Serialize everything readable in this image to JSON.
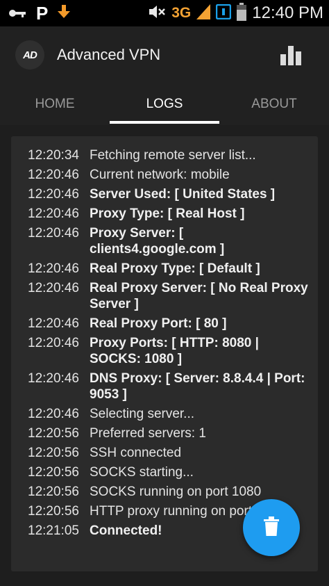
{
  "status_bar": {
    "icons": [
      "key-icon",
      "parking-p-icon",
      "download-arrow-icon",
      "mute-icon",
      "signal-icon",
      "sim-icon",
      "battery-icon"
    ],
    "p_label": "P",
    "network": "3G",
    "time": "12:40",
    "ampm": "PM",
    "accent": "#f3a233"
  },
  "appbar": {
    "logo_text": "AD",
    "title": "Advanced VPN",
    "menu_icon": "bar-chart-icon"
  },
  "tabs": [
    {
      "label": "HOME"
    },
    {
      "label": "LOGS",
      "active": true
    },
    {
      "label": "ABOUT"
    }
  ],
  "logs": [
    {
      "time": "12:20:34",
      "text": "Fetching remote server list..."
    },
    {
      "time": "12:20:46",
      "text": "Current network: mobile"
    },
    {
      "time": "12:20:46",
      "text": "Server Used: [ United States ]"
    },
    {
      "time": "12:20:46",
      "text": "Proxy Type: [ Real Host ]"
    },
    {
      "time": "12:20:46",
      "text": "Proxy Server: [ clients4.google.com ]"
    },
    {
      "time": "12:20:46",
      "text": "Real Proxy Type: [ Default ]"
    },
    {
      "time": "12:20:46",
      "text": "Real Proxy Server: [ No Real Proxy Server ]"
    },
    {
      "time": "12:20:46",
      "text": "Real Proxy Port: [ 80 ]"
    },
    {
      "time": "12:20:46",
      "text": "Proxy Ports: [ HTTP: 8080 | SOCKS: 1080 ]"
    },
    {
      "time": "12:20:46",
      "text": "DNS Proxy: [ Server: 8.8.4.4 | Port: 9053 ]"
    },
    {
      "time": "12:20:46",
      "text": "Selecting server..."
    },
    {
      "time": "12:20:56",
      "text": "Preferred servers: 1"
    },
    {
      "time": "12:20:56",
      "text": "SSH connected"
    },
    {
      "time": "12:20:56",
      "text": "SOCKS starting..."
    },
    {
      "time": "12:20:56",
      "text": "SOCKS running on port 1080"
    },
    {
      "time": "12:20:56",
      "text": "HTTP proxy running on port 8080"
    },
    {
      "time": "12:21:05",
      "text": "Connected!"
    }
  ],
  "fab": {
    "icon": "trash-icon",
    "color": "#1e9cf0"
  }
}
